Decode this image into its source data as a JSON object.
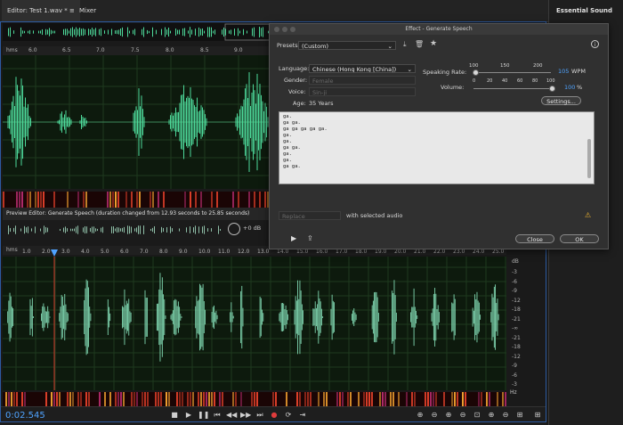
{
  "tabs": {
    "editor": "Editor: Test 1.wav *",
    "mixer": "Mixer"
  },
  "essential_sound": {
    "title": "Essential Sound"
  },
  "ruler_top": {
    "unit": "hms",
    "ticks": [
      "6.0",
      "6.5",
      "7.0",
      "7.5",
      "8.0",
      "8.5",
      "9.0"
    ]
  },
  "preview": {
    "title": "Preview Editor: Generate Speech (duration changed from 12.93 seconds to 25.85 seconds)",
    "gain": "+0 dB"
  },
  "ruler_bottom": {
    "unit": "hms",
    "ticks": [
      "1.0",
      "2.0",
      "3.0",
      "4.0",
      "5.0",
      "6.0",
      "7.0",
      "8.0",
      "9.0",
      "10.0",
      "11.0",
      "12.0",
      "13.0",
      "14.0",
      "15.0",
      "16.0",
      "17.0",
      "18.0",
      "19.0",
      "20.0",
      "21.0",
      "22.0",
      "23.0",
      "24.0",
      "25.0"
    ]
  },
  "db_scale": {
    "unit": "dB",
    "labels": [
      "-3",
      "-6",
      "-9",
      "-12",
      "-18",
      "-21",
      "-∞",
      "-21",
      "-18",
      "-12",
      "-9",
      "-6",
      "-3"
    ],
    "hz_label": "Hz"
  },
  "transport": {
    "timecode": "0:02.545"
  },
  "dialog": {
    "title": "Effect - Generate Speech",
    "presets_label": "Presets:",
    "presets_value": "(Custom)",
    "language_label": "Language:",
    "language_value": "Chinese (Hong Kong [China])",
    "gender_label": "Gender:",
    "gender_value": "Female",
    "voice_label": "Voice:",
    "voice_value": "Sin-ji",
    "age_label": "Age:",
    "age_value": "35 Years",
    "speaking_rate_label": "Speaking Rate:",
    "speaking_rate_ticks": [
      "100",
      "150",
      "200"
    ],
    "speaking_rate_value": "105",
    "speaking_rate_unit": "WPM",
    "volume_label": "Volume:",
    "volume_ticks": [
      "0",
      "20",
      "40",
      "60",
      "80",
      "100"
    ],
    "volume_value": "100",
    "volume_unit": "%",
    "settings_button": "Settings...",
    "text_lines": [
      "ga.",
      "ga ga.",
      "ga ga ga ga ga.",
      "",
      "ga.",
      "ga.",
      "ga ga.",
      "ga.",
      "ga.",
      "ga ga."
    ],
    "replace_value": "Replace",
    "with_selected": "with selected audio",
    "close_button": "Close",
    "ok_button": "OK"
  },
  "colors": {
    "waveform": "#4dd99a",
    "waveform_bottom": "#7fd6b0",
    "playhead": "#d23a2a",
    "accent": "#4fa3ff"
  }
}
